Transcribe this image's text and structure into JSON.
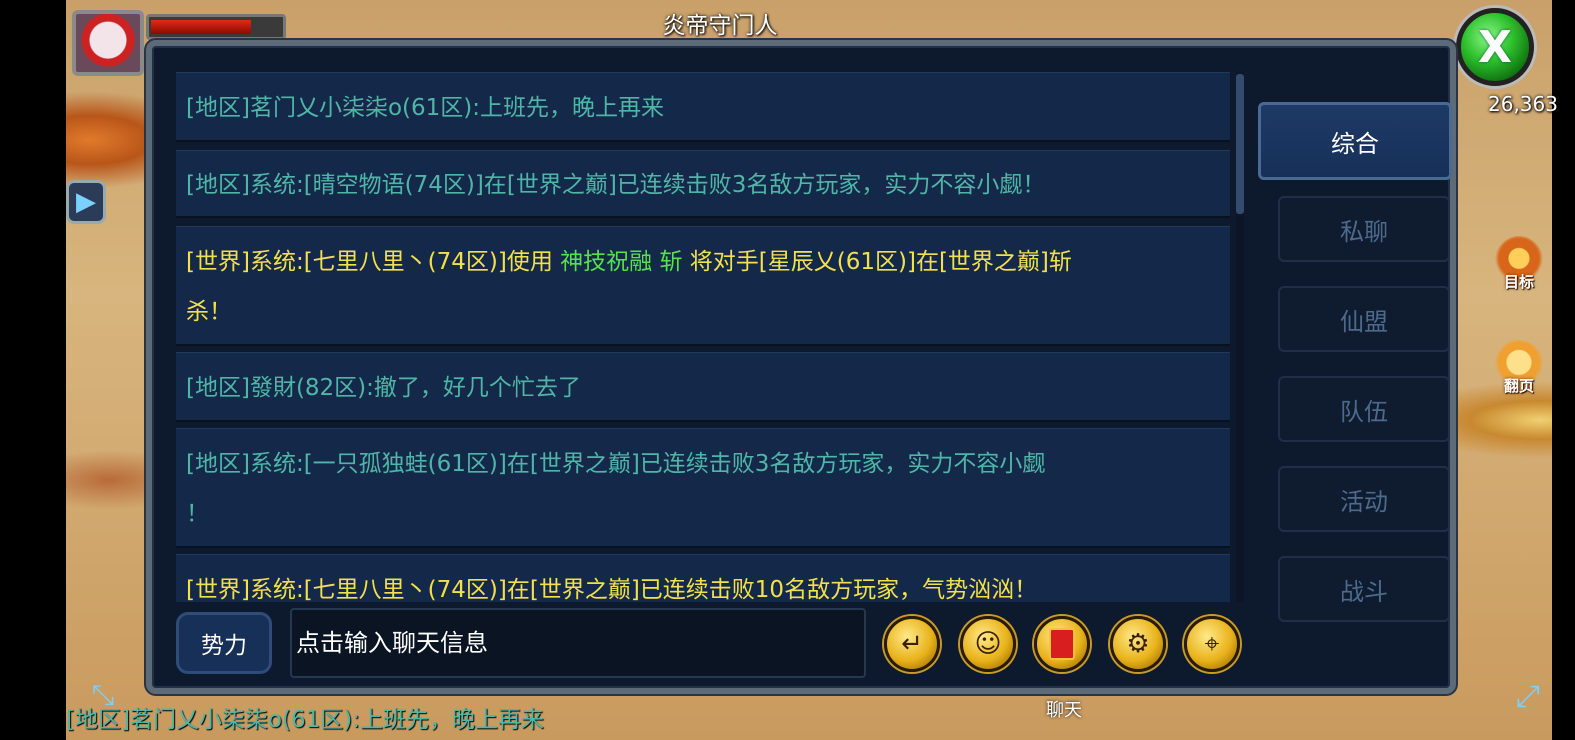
{
  "hud": {
    "npc_title": "炎帝守门人",
    "power_value": "26,363",
    "hp_fraction": 0.77,
    "target_label": "目标",
    "flip_label": "翻页",
    "close_symbol": "X"
  },
  "chat": {
    "messages": [
      {
        "channel": "local",
        "text": "[地区]茗门乂小柒柒o(61区):上班先，晚上再来"
      },
      {
        "channel": "local",
        "text": "[地区]系统:[晴空物语(74区)]在[世界之巅]已连续击败3名敌方玩家，实力不容小觑！"
      },
      {
        "channel": "world",
        "text_a": "[世界]系统:[七里八里丶(74区)]使用",
        "skill": "神技祝融 斩",
        "text_b": "将对手[星辰乂(61区)]在[世界之巅]斩",
        "text_c": "杀！"
      },
      {
        "channel": "local",
        "text": "[地区]發財(82区):撤了，好几个忙去了"
      },
      {
        "channel": "local",
        "text_a": "[地区]系统:[一只孤独蛙(61区)]在[世界之巅]已连续击败3名敌方玩家，实力不容小觑",
        "text_b": "！"
      },
      {
        "channel": "world",
        "text": "[世界]系统:[七里八里丶(74区)]在[世界之巅]已连续击败10名敌方玩家，气势汹汹！"
      }
    ],
    "tabs": [
      "综合",
      "私聊",
      "仙盟",
      "队伍",
      "活动",
      "战斗"
    ],
    "active_tab": "综合",
    "faction_button": "势力",
    "input_placeholder": "点击输入聊天信息",
    "icons": [
      "return-icon",
      "emoji-icon",
      "red-packet-icon",
      "gear-icon",
      "location-icon"
    ]
  },
  "bottom": {
    "last_message": "[地区]茗门乂小柒柒o(61区):上班先，晚上再来",
    "chat_label": "聊天"
  },
  "colors": {
    "local_channel": "#4fb6a7",
    "world_channel": "#f3e04a",
    "skill_highlight": "#59e04a",
    "panel_bg": "#0d1a2e"
  }
}
